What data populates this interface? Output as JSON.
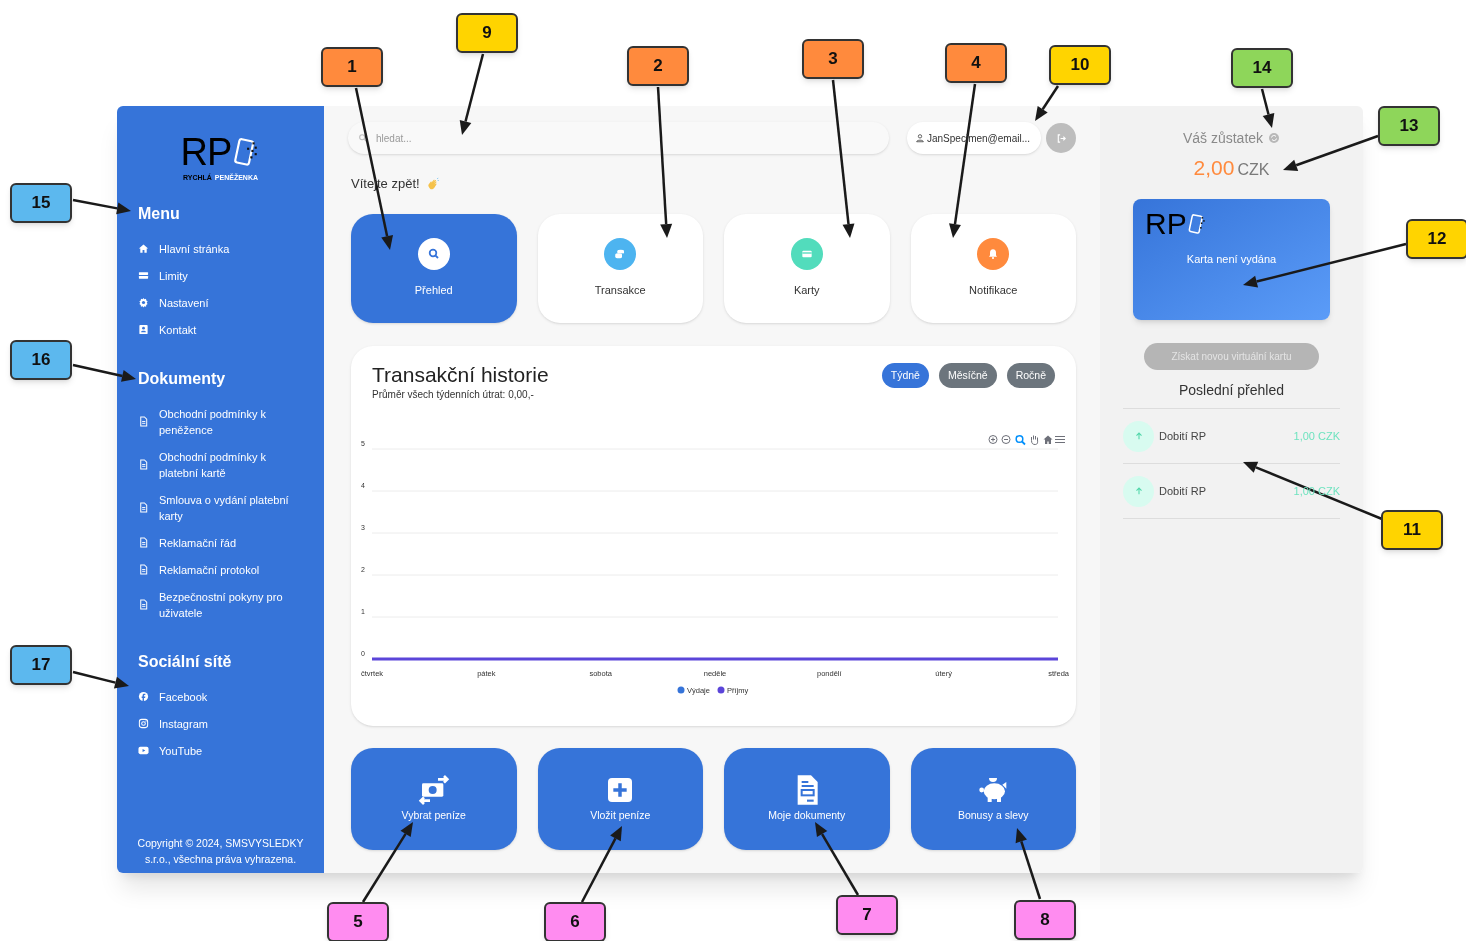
{
  "logo": {
    "mark": "RP",
    "tagline": [
      "RYCHLÁ",
      "PENĚŽENKA"
    ]
  },
  "sidebar": {
    "sections": [
      {
        "title": "Menu",
        "items": [
          "Hlavní stránka",
          "Limity",
          "Nastavení",
          "Kontakt"
        ]
      },
      {
        "title": "Dokumenty",
        "items": [
          "Obchodní podmínky k peněžence",
          "Obchodní podmínky k platební kartě",
          "Smlouva o vydání platební karty",
          "Reklamační řád",
          "Reklamační protokol",
          "Bezpečnostní pokyny pro uživatele"
        ]
      },
      {
        "title": "Sociální sítě",
        "items": [
          "Facebook",
          "Instagram",
          "YouTube"
        ]
      }
    ],
    "footer": "Copyright © 2024, SMSVYSLEDKY s.r.o., všechna práva vyhrazena."
  },
  "search": {
    "placeholder": "hledat..."
  },
  "user": {
    "email": "JanSpecimen@email..."
  },
  "greeting": "Vítejte zpět!",
  "tiles": [
    {
      "label": "Přehled",
      "selected": true,
      "color": "#ffffff"
    },
    {
      "label": "Transakce",
      "selected": false,
      "color": "#4db4f0"
    },
    {
      "label": "Karty",
      "selected": false,
      "color": "#52dcbc"
    },
    {
      "label": "Notifikace",
      "selected": false,
      "color": "#ff8a3d"
    }
  ],
  "history": {
    "title": "Transakční historie",
    "subtitle": "Průměr všech týdenních útrat: 0,00,-",
    "periods": [
      {
        "label": "Týdně",
        "selected": true
      },
      {
        "label": "Měsíčně",
        "selected": false
      },
      {
        "label": "Ročně",
        "selected": false
      }
    ],
    "chart_data": {
      "type": "line",
      "categories": [
        "čtvrtek",
        "pátek",
        "sobota",
        "neděle",
        "pondělí",
        "úterý",
        "středa"
      ],
      "series": [
        {
          "name": "Výdaje",
          "color": "#3674d9",
          "values": [
            null,
            null,
            null,
            null,
            null,
            null,
            null
          ]
        },
        {
          "name": "Příjmy",
          "color": "#5b45d9",
          "values": [
            0,
            0,
            0,
            0,
            0,
            0,
            0
          ]
        }
      ],
      "ylim": [
        0,
        5
      ],
      "yticks": [
        {
          "value": 0,
          "label": "0"
        },
        {
          "value": 1,
          "label": "1"
        },
        {
          "value": 2,
          "label": "2"
        },
        {
          "value": 3,
          "label": "3"
        },
        {
          "value": 4,
          "label": "4"
        },
        {
          "value": 5,
          "label": "5"
        }
      ],
      "grid": true,
      "legend": true
    }
  },
  "actions": [
    "Vybrat peníze",
    "Vložit peníze",
    "Moje dokumenty",
    "Bonusy a slevy"
  ],
  "balance": {
    "label": "Váš zůstatek",
    "amount": "2,00",
    "currency": "CZK"
  },
  "card": {
    "mark": "RP",
    "status": "Karta není vydána"
  },
  "new_card_button": {
    "label": "Získat novou virtuální kartu",
    "disabled": true
  },
  "recent": {
    "title": "Poslední přehled",
    "items": [
      {
        "label": "Dobití RP",
        "amount": "1,00 CZK"
      },
      {
        "label": "Dobití RP",
        "amount": "1,00 CZK"
      }
    ]
  },
  "callouts": [
    {
      "number": "1",
      "color": "#ff8a3d"
    },
    {
      "number": "2",
      "color": "#ff8a3d"
    },
    {
      "number": "3",
      "color": "#ff8a3d"
    },
    {
      "number": "4",
      "color": "#ff8a3d"
    },
    {
      "number": "5",
      "color": "#ff8cf0"
    },
    {
      "number": "6",
      "color": "#ff8cf0"
    },
    {
      "number": "7",
      "color": "#ff8cf0"
    },
    {
      "number": "8",
      "color": "#ff8cf0"
    },
    {
      "number": "9",
      "color": "#ffd400"
    },
    {
      "number": "10",
      "color": "#ffd400"
    },
    {
      "number": "11",
      "color": "#ffd400"
    },
    {
      "number": "12",
      "color": "#ffd400"
    },
    {
      "number": "13",
      "color": "#8ed65a"
    },
    {
      "number": "14",
      "color": "#8ed65a"
    },
    {
      "number": "15",
      "color": "#5cb8ee"
    },
    {
      "number": "16",
      "color": "#5cb8ee"
    },
    {
      "number": "17",
      "color": "#5cb8ee"
    }
  ]
}
